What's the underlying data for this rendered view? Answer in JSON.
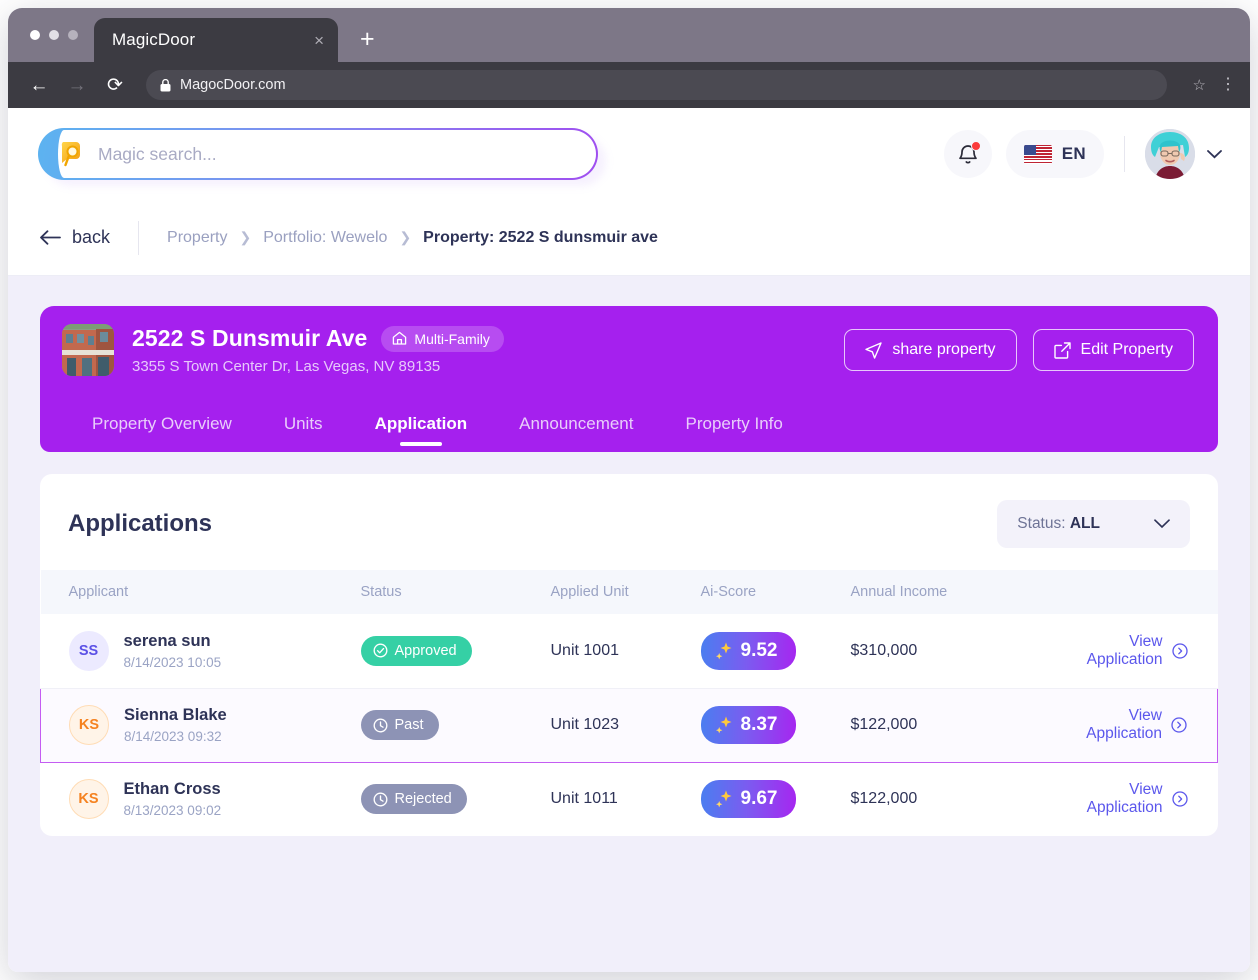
{
  "browser": {
    "tab_title": "MagicDoor",
    "close_label": "×",
    "new_tab_label": "+",
    "back_label": "←",
    "forward_label": "→",
    "reload_label": "⟳",
    "url": "MagocDoor.com",
    "star_label": "☆",
    "menu_label": "⋮"
  },
  "appbar": {
    "search_placeholder": "Magic search...",
    "search_value": "",
    "language": "EN"
  },
  "breadcrumb": {
    "back_label": "back",
    "items": [
      {
        "label": "Property",
        "active": false
      },
      {
        "label": "Portfolio: Wewelo",
        "active": false
      },
      {
        "label": "Property: 2522 S dunsmuir ave",
        "active": true
      }
    ],
    "separator": "❯"
  },
  "property": {
    "name": "2522 S Dunsmuir Ave",
    "type_badge": "Multi-Family",
    "address": "3355 S Town Center Dr, Las Vegas, NV 89135",
    "share_label": "share property",
    "edit_label": "Edit Property",
    "tabs": [
      {
        "label": "Property Overview",
        "active": false
      },
      {
        "label": "Units",
        "active": false
      },
      {
        "label": "Application",
        "active": true
      },
      {
        "label": "Announcement",
        "active": false
      },
      {
        "label": "Property Info",
        "active": false
      }
    ]
  },
  "applications": {
    "title": "Applications",
    "filter_label": "Status:",
    "filter_value": "ALL",
    "columns": [
      "Applicant",
      "Status",
      "Applied Unit",
      "Ai-Score",
      "Annual Income",
      ""
    ],
    "view_link_label": "View Application",
    "rows": [
      {
        "initials": "SS",
        "initials_style": "ss",
        "name": "serena sun",
        "date": "8/14/2023 10:05",
        "status": "Approved",
        "status_style": "approved",
        "status_icon": "check-circle-icon",
        "unit": "Unit 1001",
        "score": "9.52",
        "income": "$310,000",
        "selected": false
      },
      {
        "initials": "KS",
        "initials_style": "ks",
        "name": "Sienna Blake",
        "date": "8/14/2023 09:32",
        "status": "Past",
        "status_style": "neutral",
        "status_icon": "clock-icon",
        "unit": "Unit 1023",
        "score": "8.37",
        "income": "$122,000",
        "selected": true
      },
      {
        "initials": "KS",
        "initials_style": "ks",
        "name": "Ethan Cross",
        "date": "8/13/2023 09:02",
        "status": "Rejected",
        "status_style": "neutral",
        "status_icon": "clock-icon",
        "unit": "Unit 1011",
        "score": "9.67",
        "income": "$122,000",
        "selected": false
      }
    ]
  },
  "colors": {
    "brand_purple": "#a520ee",
    "accent_indigo": "#5b57ec",
    "status_green": "#35d0a5",
    "status_neutral": "#8d93b5",
    "page_bg": "#f1effa",
    "selected_row_border": "#c45cf2"
  }
}
